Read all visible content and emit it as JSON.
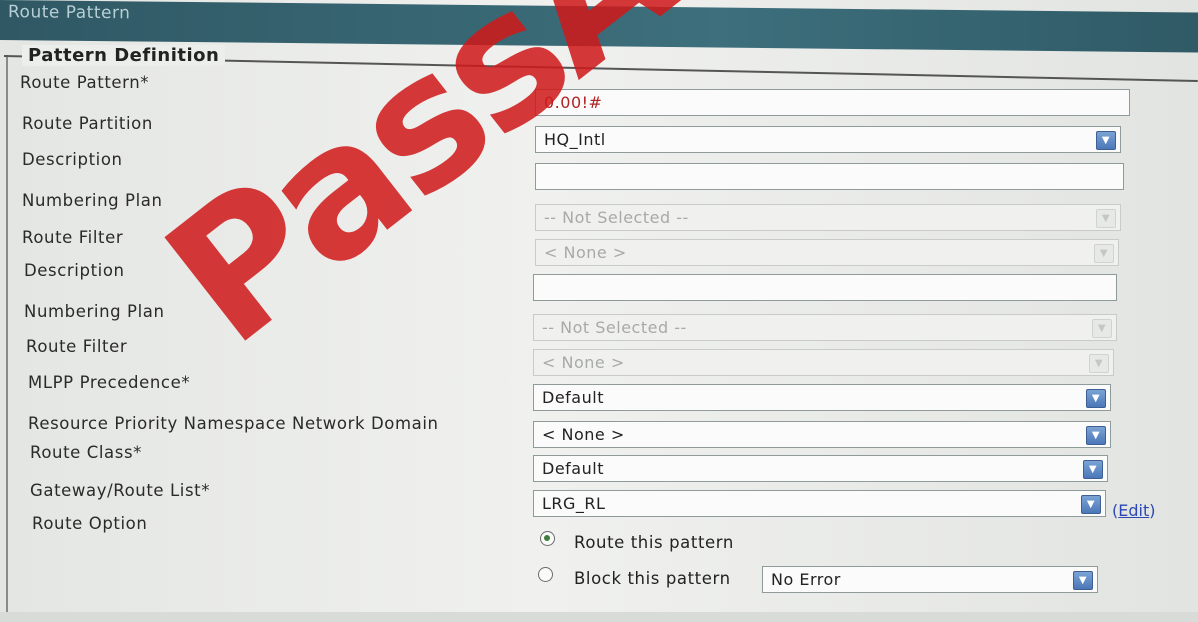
{
  "window": {
    "title": "Route Pattern"
  },
  "section": {
    "title": "Pattern Definition"
  },
  "labels": [
    "Route Pattern*",
    "Route Partition",
    "Description",
    "Numbering Plan",
    "Route Filter",
    "Description",
    "Numbering Plan",
    "Route Filter",
    "MLPP Precedence*",
    "Resource Priority Namespace Network Domain",
    "Route Class*",
    "Gateway/Route List*",
    "Route Option"
  ],
  "fields": {
    "route_pattern": "0.00!#",
    "route_partition": "HQ_Intl",
    "description": "",
    "numbering_plan": "-- Not Selected --",
    "route_filter": "< None >",
    "description_2": "",
    "numbering_plan_2": "-- Not Selected --",
    "route_filter_2": "< None >",
    "mlpp_precedence": "Default",
    "resource_priority": "< None >",
    "route_class": "Default",
    "gateway_route_list": "LRG_RL",
    "block_reason": "No Error"
  },
  "edit_link": {
    "open": "(",
    "label": "Edit",
    "close": ")"
  },
  "route_option": {
    "route_label": "Route this pattern",
    "block_label": "Block this pattern",
    "selected": "route"
  },
  "icons": {
    "dropdown": "chevron-down-icon",
    "radio": "radio-button-icon"
  },
  "colors": {
    "header": "#3d6f7c",
    "watermark": "#cf1818",
    "link": "#2d47b5",
    "dropdown_button": "#4c77b8"
  },
  "watermark": {
    "text": "PassA"
  }
}
